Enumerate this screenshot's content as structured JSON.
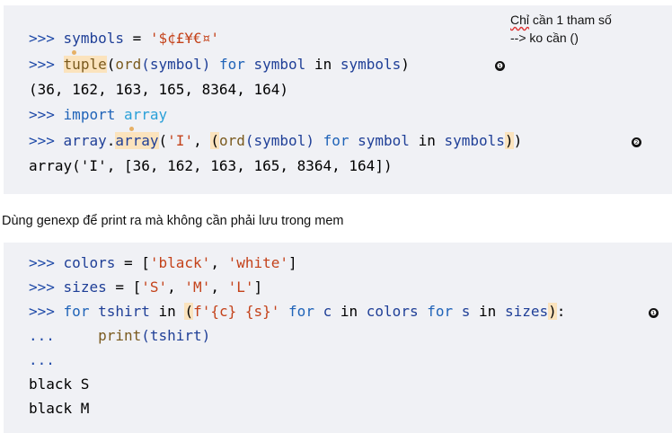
{
  "note": {
    "line1_wavy": "Chỉ",
    "line1_rest": " cần 1 tham số",
    "line2": "--> ko cần ()"
  },
  "block1": {
    "l1": {
      "prompt": ">>>",
      "name": "symbols",
      "eq": " = ",
      "str": "'$¢£¥€¤'"
    },
    "l2": {
      "prompt": ">>>",
      "fn": "tuple",
      "open": "(",
      "ord": "ord",
      "arg": "(symbol)",
      "for": "for",
      "var": "symbol",
      "in": "in",
      "seq": "symbols",
      "close": ")"
    },
    "l3": {
      "text": "(36, 162, 163, 165, 8364, 164)"
    },
    "l4": {
      "prompt": ">>>",
      "import": "import",
      "mod": "array"
    },
    "l5": {
      "prompt": ">>>",
      "mod": "array",
      "dot": ".",
      "fn": "array",
      "open": "(",
      "str": "'I'",
      "comma": ", ",
      "paren": "(",
      "ord": "ord",
      "arg": "(symbol)",
      "for": "for",
      "var": "symbol",
      "in": "in",
      "seq": "symbols",
      "close_hl": ")",
      "close": ")"
    },
    "l6": {
      "text": "array('I', [36, 162, 163, 165, 8364, 164])"
    },
    "callout1": "❶",
    "callout2": "❷"
  },
  "caption": "Dùng genexp để print ra mà không cần phải lưu trong mem",
  "block2": {
    "l1": {
      "prompt": ">>>",
      "name": "colors",
      "eq": " = [",
      "s1": "'black'",
      "comma": ", ",
      "s2": "'white'",
      "close": "]"
    },
    "l2": {
      "prompt": ">>>",
      "name": "sizes",
      "eq": " = [",
      "s1": "'S'",
      "c1": ", ",
      "s2": "'M'",
      "c2": ", ",
      "s3": "'L'",
      "close": "]"
    },
    "l3": {
      "prompt": ">>>",
      "for": "for",
      "var": "tshirt",
      "in": "in",
      "paren": "(",
      "fstr": "f'{c} {s}'",
      "for2": "for",
      "c": "c",
      "in2": "in",
      "colors": "colors",
      "for3": "for",
      "s": "s",
      "in3": "in",
      "sizes": "sizes",
      "close": ")",
      "colon": ":"
    },
    "l4": {
      "prompt": "...",
      "fn": "print",
      "arg": "(tshirt)"
    },
    "l5": {
      "prompt": "..."
    },
    "l6": {
      "text": "black S"
    },
    "l7": {
      "text": "black M"
    },
    "callout1": "❶"
  }
}
